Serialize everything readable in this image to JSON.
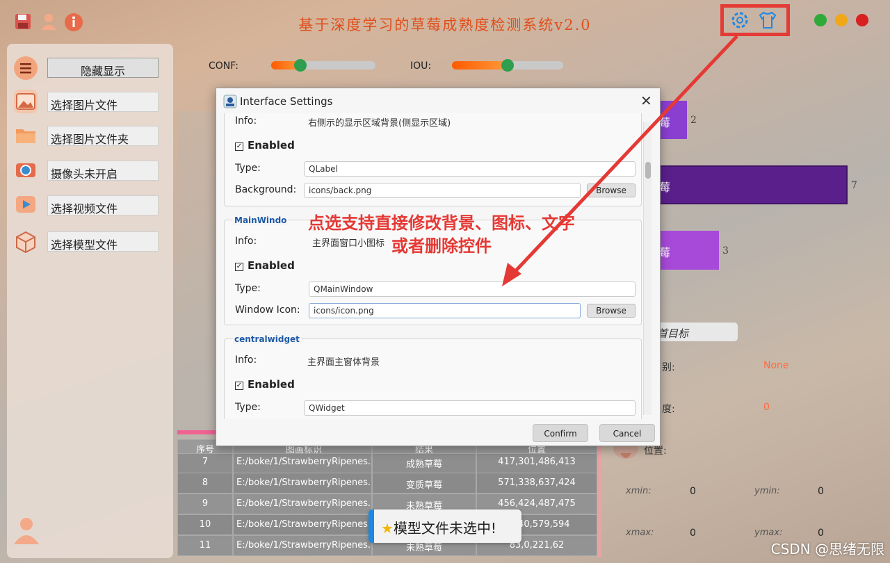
{
  "header": {
    "title": "基于深度学习的草莓成熟度检测系统v2.0"
  },
  "sidebar": {
    "items": [
      {
        "label": "隐藏显示"
      },
      {
        "label": "选择图片文件"
      },
      {
        "label": "选择图片文件夹"
      },
      {
        "label": "摄像头未开启"
      },
      {
        "label": "选择视频文件"
      },
      {
        "label": "选择模型文件"
      }
    ]
  },
  "sliders": {
    "conf_label": "CONF:",
    "conf_value": 0.28,
    "iou_label": "IOU:",
    "iou_value": 0.5
  },
  "bars": [
    {
      "label": "莓",
      "count": "2"
    },
    {
      "label": "莓",
      "count": "7"
    },
    {
      "label": "莓",
      "count": "3"
    }
  ],
  "result_panel": {
    "target_button": "首目标",
    "class_label": "别:",
    "class_value": "None",
    "conf_label": "度:",
    "conf_value": "0",
    "pos_label": "位置:",
    "xmin_label": "xmin:",
    "xmin": "0",
    "ymin_label": "ymin:",
    "ymin": "0",
    "xmax_label": "xmax:",
    "xmax": "0",
    "ymax_label": "ymax:",
    "ymax": "0"
  },
  "table": {
    "headers": [
      "序号",
      "图画标识",
      "结果",
      "位置"
    ],
    "rows": [
      {
        "idx": "7",
        "path": "E:/boke/1/StrawberryRipenes...",
        "result": "成熟草莓",
        "pos": "417,301,486,413"
      },
      {
        "idx": "8",
        "path": "E:/boke/1/StrawberryRipenes...",
        "result": "变质草莓",
        "pos": "571,338,637,424"
      },
      {
        "idx": "9",
        "path": "E:/boke/1/StrawberryRipenes...",
        "result": "未熟草莓",
        "pos": "456,424,487,475"
      },
      {
        "idx": "10",
        "path": "E:/boke/1/StrawberryRipenes...",
        "result": "",
        "pos": "5,540,579,594"
      },
      {
        "idx": "11",
        "path": "E:/boke/1/StrawberryRipenes...",
        "result": "未熟草莓",
        "pos": "83,0,221,62"
      }
    ]
  },
  "dialog": {
    "title": "Interface Settings",
    "group0": {
      "info_label": "Info:",
      "info_value": "右侧示的显示区域背景(侧显示区域)",
      "enabled": "Enabled",
      "type_label": "Type:",
      "type_value": "QLabel",
      "bg_label": "Background:",
      "bg_value": "icons/back.png",
      "browse": "Browse"
    },
    "group1": {
      "title": "MainWindo",
      "info_label": "Info:",
      "info_value": "主界面窗口小图标",
      "enabled": "Enabled",
      "type_label": "Type:",
      "type_value": "QMainWindow",
      "icon_label": "Window Icon:",
      "icon_value": "icons/icon.png",
      "browse": "Browse"
    },
    "group2": {
      "title": "centralwidget",
      "info_label": "Info:",
      "info_value": "主界面主窗体背景",
      "enabled": "Enabled",
      "type_label": "Type:",
      "type_value": "QWidget"
    },
    "confirm": "Confirm",
    "cancel": "Cancel"
  },
  "annotation": {
    "line1": "点选支持直接修改背景、图标、文字",
    "line2": "或者删除控件"
  },
  "toast": {
    "text": "模型文件未选中!"
  },
  "watermark": "CSDN @思绪无限",
  "colors": {
    "accent": "#1e88e5",
    "annotation": "#e53935",
    "title": "#e04f1c",
    "bar_purple": "#8a3fd1",
    "bar_dark": "#5b1f8c"
  }
}
